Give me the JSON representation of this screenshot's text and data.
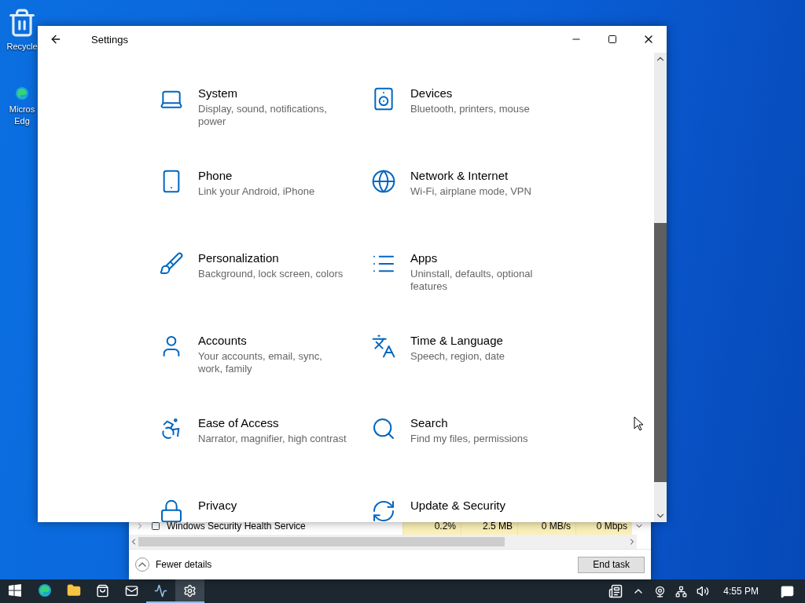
{
  "desktop_icons": [
    {
      "lines": [
        "Recycle"
      ]
    },
    {
      "lines": [
        "Micros",
        "Edg"
      ]
    }
  ],
  "task_manager": {
    "row": {
      "name": "Windows Security Health Service",
      "cells": [
        "0.2%",
        "2.5 MB",
        "0 MB/s",
        "0 Mbps"
      ]
    },
    "footer_link": "Fewer details",
    "button": "End task"
  },
  "settings": {
    "title": "Settings",
    "categories": [
      {
        "title": "System",
        "subtitle": "Display, sound, notifications, power"
      },
      {
        "title": "Devices",
        "subtitle": "Bluetooth, printers, mouse"
      },
      {
        "title": "Phone",
        "subtitle": "Link your Android, iPhone"
      },
      {
        "title": "Network & Internet",
        "subtitle": "Wi-Fi, airplane mode, VPN"
      },
      {
        "title": "Personalization",
        "subtitle": "Background, lock screen, colors"
      },
      {
        "title": "Apps",
        "subtitle": "Uninstall, defaults, optional features"
      },
      {
        "title": "Accounts",
        "subtitle": "Your accounts, email, sync, work, family"
      },
      {
        "title": "Time & Language",
        "subtitle": "Speech, region, date"
      },
      {
        "title": "Ease of Access",
        "subtitle": "Narrator, magnifier, high contrast"
      },
      {
        "title": "Search",
        "subtitle": "Find my files, permissions"
      },
      {
        "title": "Privacy"
      },
      {
        "title": "Update & Security"
      }
    ]
  },
  "taskbar": {
    "apps": [
      {
        "running": false,
        "selected": false
      },
      {
        "running": false,
        "selected": false
      },
      {
        "running": false,
        "selected": false
      },
      {
        "running": false,
        "selected": false
      },
      {
        "running": true,
        "selected": false
      },
      {
        "running": true,
        "selected": true
      }
    ],
    "clock": "4:55 PM"
  }
}
